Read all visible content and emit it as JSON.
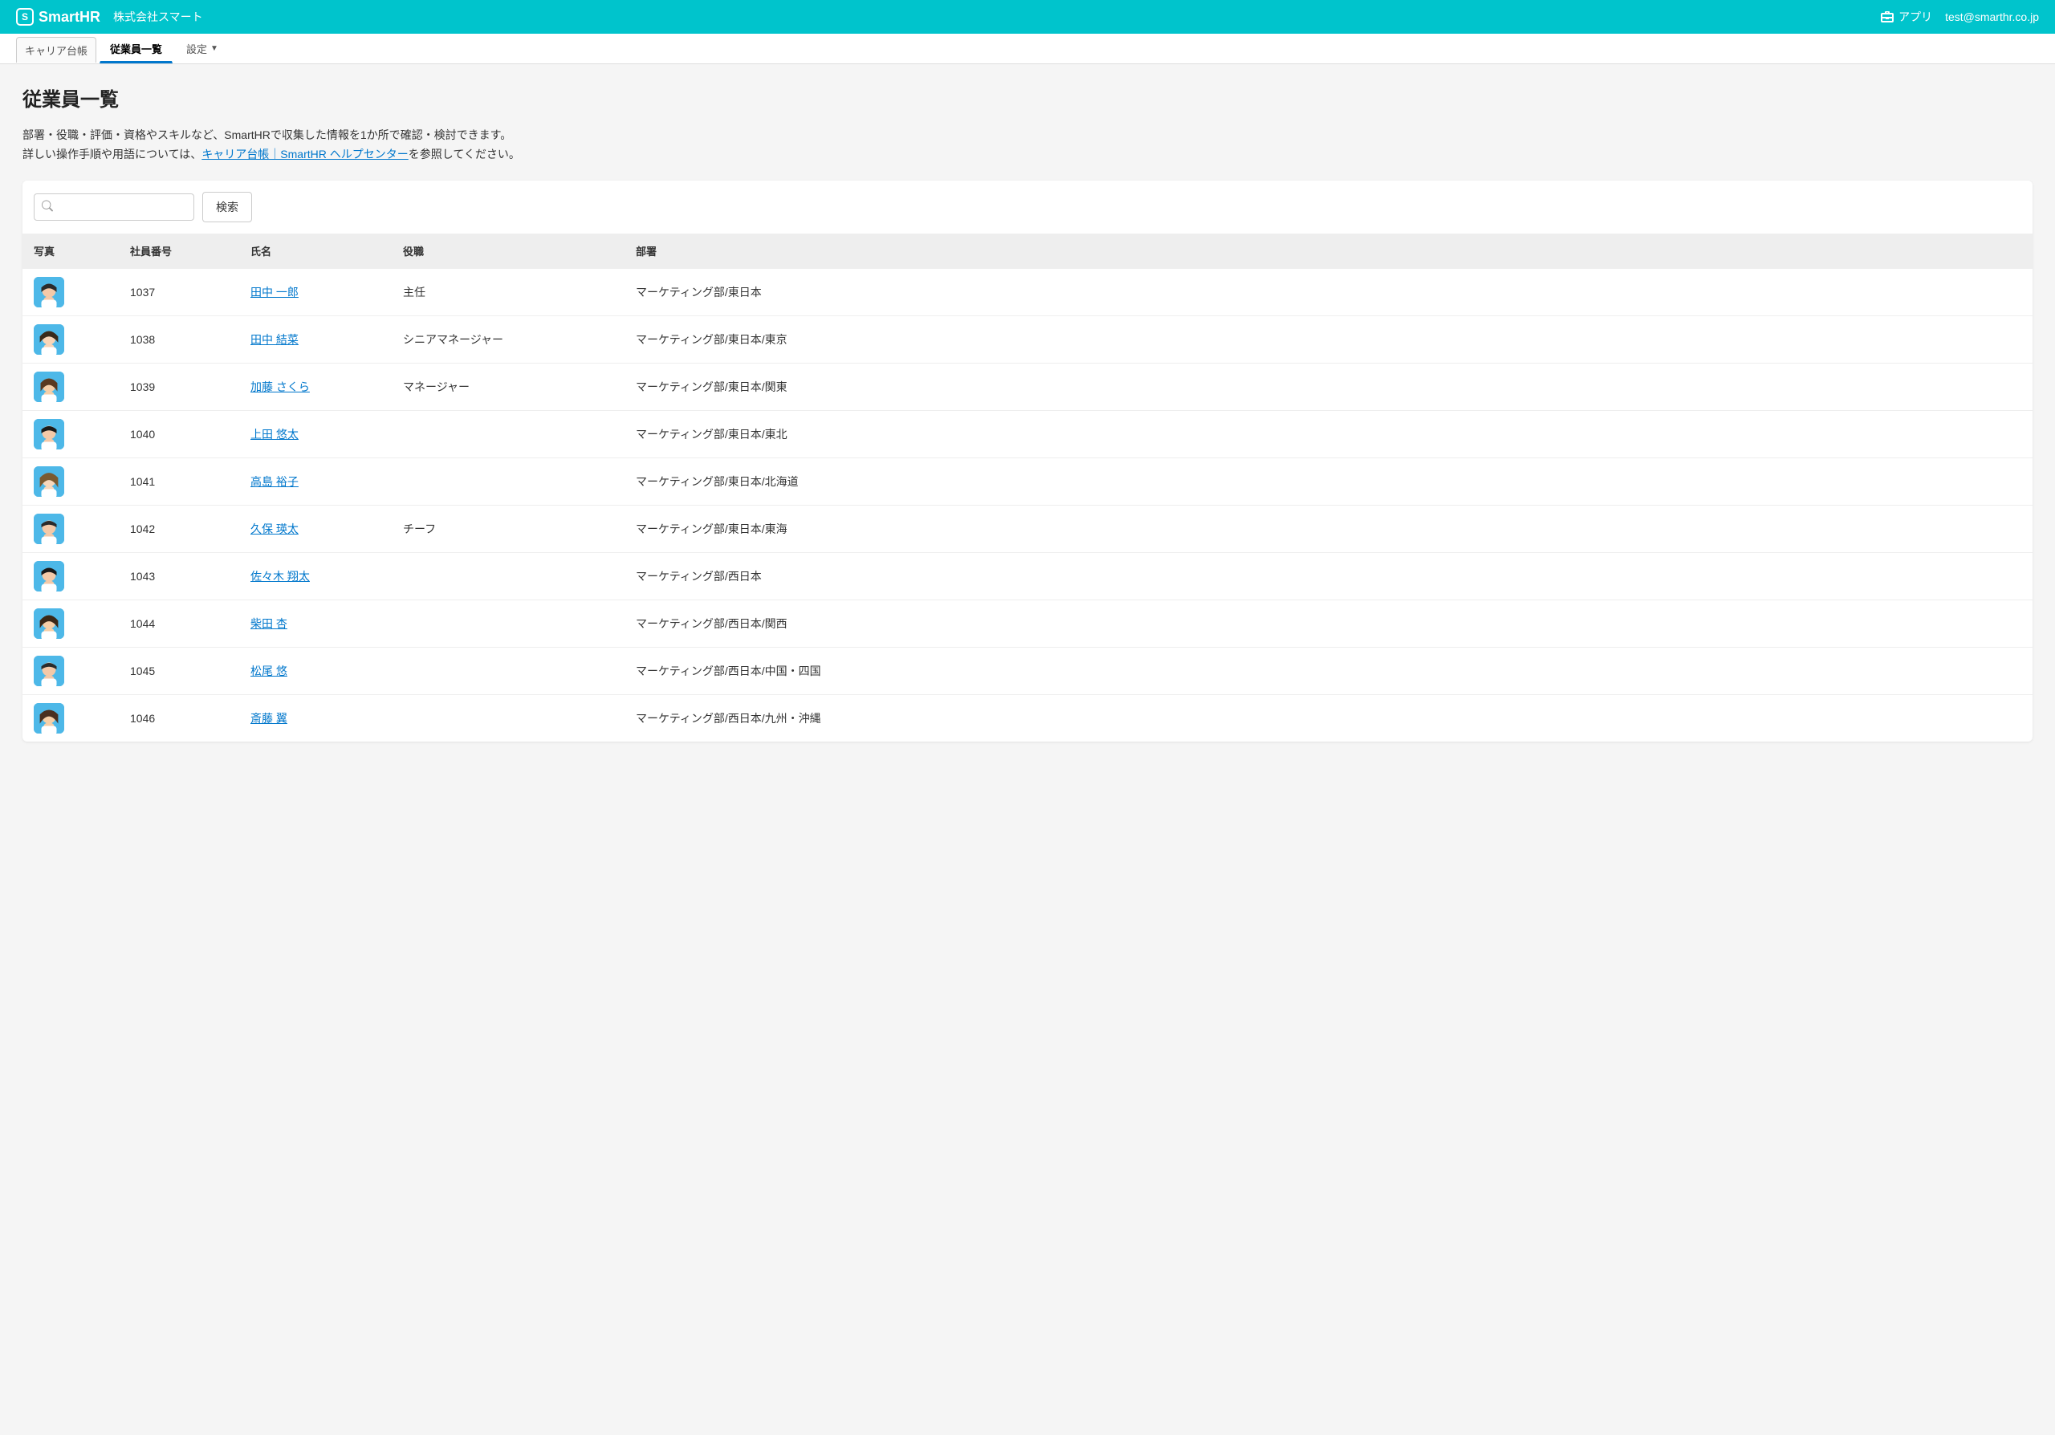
{
  "header": {
    "logo_text": "SmartHR",
    "logo_badge": "S",
    "company_name": "株式会社スマート",
    "app_label": "アプリ",
    "user_email": "test@smarthr.co.jp"
  },
  "tabs": {
    "career": "キャリア台帳",
    "employees": "従業員一覧",
    "settings": "設定"
  },
  "page": {
    "title": "従業員一覧",
    "desc_line1": "部署・役職・評価・資格やスキルなど、SmartHRで収集した情報を1か所で確認・検討できます。",
    "desc_line2_pre": "詳しい操作手順や用語については、",
    "desc_link": "キャリア台帳｜SmartHR ヘルプセンター",
    "desc_line2_post": "を参照してください。"
  },
  "search": {
    "button_label": "検索"
  },
  "table": {
    "headers": {
      "photo": "写真",
      "employee_id": "社員番号",
      "name": "氏名",
      "position": "役職",
      "department": "部署"
    },
    "rows": [
      {
        "id": "1037",
        "name": "田中 一郎",
        "position": "主任",
        "department": "マーケティング部/東日本"
      },
      {
        "id": "1038",
        "name": "田中 結菜",
        "position": "シニアマネージャー",
        "department": "マーケティング部/東日本/東京"
      },
      {
        "id": "1039",
        "name": "加藤 さくら",
        "position": "マネージャー",
        "department": "マーケティング部/東日本/関東"
      },
      {
        "id": "1040",
        "name": "上田 悠太",
        "position": "",
        "department": "マーケティング部/東日本/東北"
      },
      {
        "id": "1041",
        "name": "高島 裕子",
        "position": "",
        "department": "マーケティング部/東日本/北海道"
      },
      {
        "id": "1042",
        "name": "久保 瑛太",
        "position": "チーフ",
        "department": "マーケティング部/東日本/東海"
      },
      {
        "id": "1043",
        "name": "佐々木 翔太",
        "position": "",
        "department": "マーケティング部/西日本"
      },
      {
        "id": "1044",
        "name": "柴田 杏",
        "position": "",
        "department": "マーケティング部/西日本/関西"
      },
      {
        "id": "1045",
        "name": "松尾 悠",
        "position": "",
        "department": "マーケティング部/西日本/中国・四国"
      },
      {
        "id": "1046",
        "name": "斎藤 翼",
        "position": "",
        "department": "マーケティング部/西日本/九州・沖縄"
      }
    ]
  }
}
